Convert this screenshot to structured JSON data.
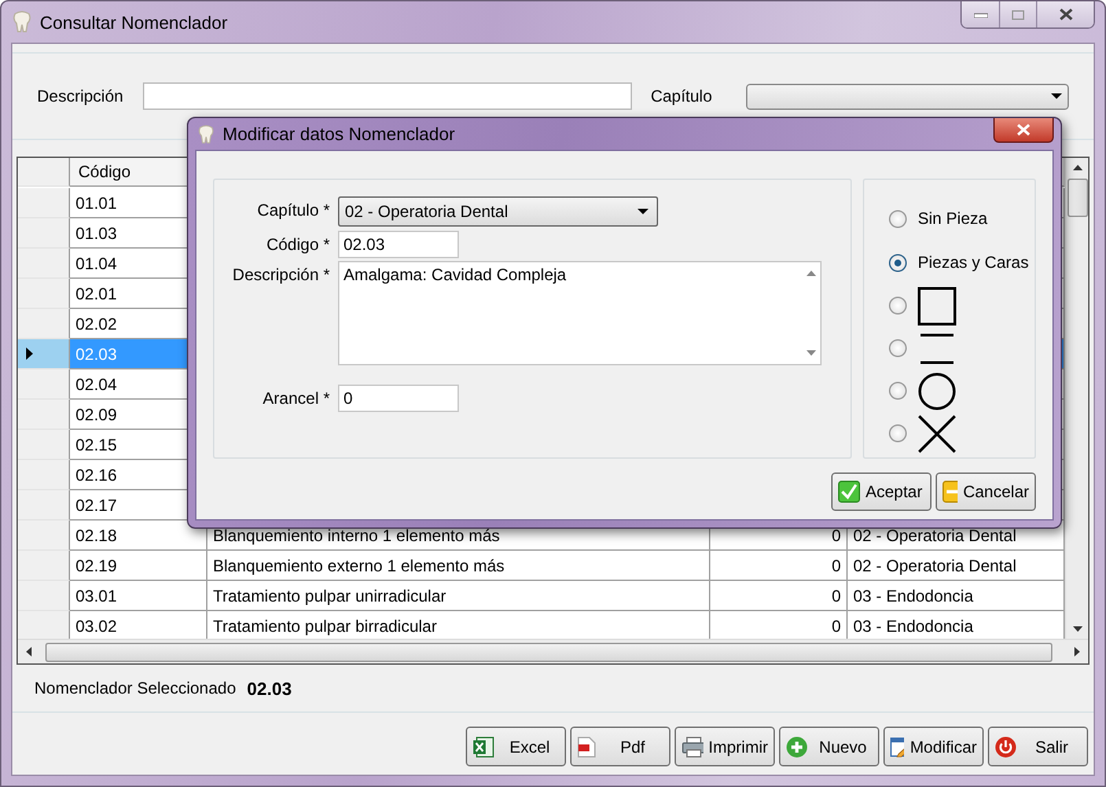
{
  "window": {
    "title": "Consultar Nomenclador"
  },
  "filters": {
    "description_label": "Descripción",
    "chapter_label": "Capítulo"
  },
  "table": {
    "columns": [
      "Código"
    ],
    "rows": [
      {
        "code": "01.01",
        "selected": false
      },
      {
        "code": "01.03",
        "selected": false
      },
      {
        "code": "01.04",
        "selected": false
      },
      {
        "code": "02.01",
        "selected": false
      },
      {
        "code": "02.02",
        "selected": false
      },
      {
        "code": "02.03",
        "selected": true
      },
      {
        "code": "02.04",
        "selected": false
      },
      {
        "code": "02.09",
        "selected": false
      },
      {
        "code": "02.15",
        "selected": false
      },
      {
        "code": "02.16",
        "selected": false
      },
      {
        "code": "02.17",
        "selected": false
      },
      {
        "code": "02.18",
        "description": "Blanquemiento interno 1 elemento más",
        "fee": "0",
        "chapter": "02 - Operatoria Dental",
        "selected": false
      },
      {
        "code": "02.19",
        "description": "Blanquemiento externo 1 elemento más",
        "fee": "0",
        "chapter": "02 - Operatoria Dental",
        "selected": false
      },
      {
        "code": "03.01",
        "description": "Tratamiento pulpar unirradicular",
        "fee": "0",
        "chapter": "03 - Endodoncia",
        "selected": false
      },
      {
        "code": "03.02",
        "description": "Tratamiento pulpar birradicular",
        "fee": "0",
        "chapter": "03 - Endodoncia",
        "selected": false
      }
    ]
  },
  "selection": {
    "label": "Nomenclador Seleccionado",
    "value": "02.03"
  },
  "buttons": [
    {
      "kind": "excel",
      "label": "Excel"
    },
    {
      "kind": "pdf",
      "label": "Pdf"
    },
    {
      "kind": "print",
      "label": "Imprimir"
    },
    {
      "kind": "new",
      "label": "Nuevo"
    },
    {
      "kind": "edit",
      "label": "Modificar"
    },
    {
      "kind": "exit",
      "label": "Salir"
    }
  ],
  "dialog": {
    "title": "Modificar datos Nomenclador",
    "fields": [
      {
        "kind": "select",
        "label": "Capítulo *",
        "value": "02 - Operatoria Dental"
      },
      {
        "kind": "text",
        "label": "Código *",
        "value": "02.03"
      },
      {
        "kind": "textarea",
        "label": "Descripción *",
        "value": "Amalgama: Cavidad Compleja"
      },
      {
        "kind": "text",
        "label": "Arancel *",
        "value": "0"
      }
    ],
    "options": [
      {
        "kind": "text",
        "label": "Sin Pieza",
        "selected": false
      },
      {
        "kind": "text",
        "label": "Piezas y Caras",
        "selected": true
      },
      {
        "kind": "square",
        "selected": false
      },
      {
        "kind": "lines",
        "selected": false
      },
      {
        "kind": "circle",
        "selected": false
      },
      {
        "kind": "cross",
        "selected": false
      }
    ],
    "buttons": [
      {
        "kind": "accept",
        "label": "Aceptar"
      },
      {
        "kind": "cancel",
        "label": "Cancelar"
      }
    ]
  }
}
